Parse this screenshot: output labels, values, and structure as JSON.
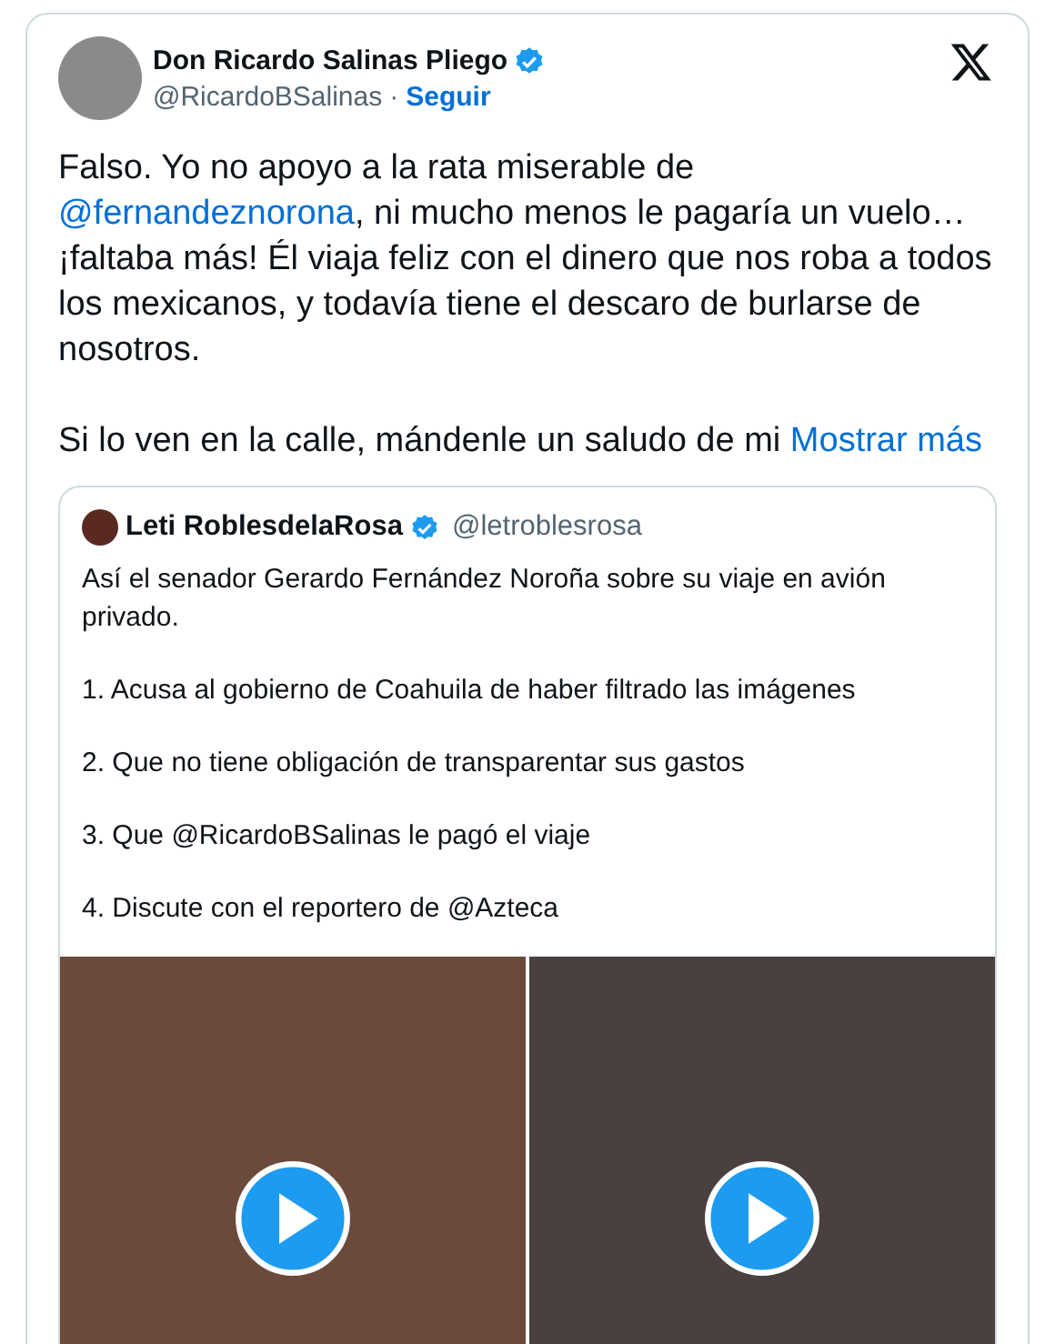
{
  "author": {
    "name": "Don Ricardo Salinas Pliego",
    "verified": true,
    "handle": "@RicardoBSalinas",
    "separator": "·",
    "follow": "Seguir"
  },
  "body": [
    [
      {
        "kind": "text",
        "text": "Falso. Yo no apoyo a la rata miserable de "
      },
      {
        "kind": "mention",
        "text": "@fernandeznorona"
      },
      {
        "kind": "text",
        "text": ", ni mucho menos le pagaría un vuelo… ¡faltaba más! Él viaja feliz con el dinero que nos roba a todos los mexicanos, y todavía tiene el descaro de burlarse de nosotros."
      }
    ],
    [
      {
        "kind": "text",
        "text": "Si lo ven en la calle, mándenle un saludo de mi "
      },
      {
        "kind": "more",
        "text": "Mostrar más"
      }
    ]
  ],
  "quote": {
    "name": "Leti RoblesdelaRosa",
    "verified": true,
    "handle": "@letroblesrosa",
    "paragraphs": [
      "Así el senador Gerardo Fernández Noroña sobre su viaje en avión privado.",
      "1. Acusa al gobierno de Coahuila de haber filtrado las imágenes",
      "2. Que no tiene obligación de transparentar sus gastos",
      "3. Que @RicardoBSalinas le pagó el viaje",
      "4. Discute con el reportero de @Azteca"
    ],
    "media": [
      {
        "kind": "video"
      },
      {
        "kind": "video"
      }
    ]
  }
}
